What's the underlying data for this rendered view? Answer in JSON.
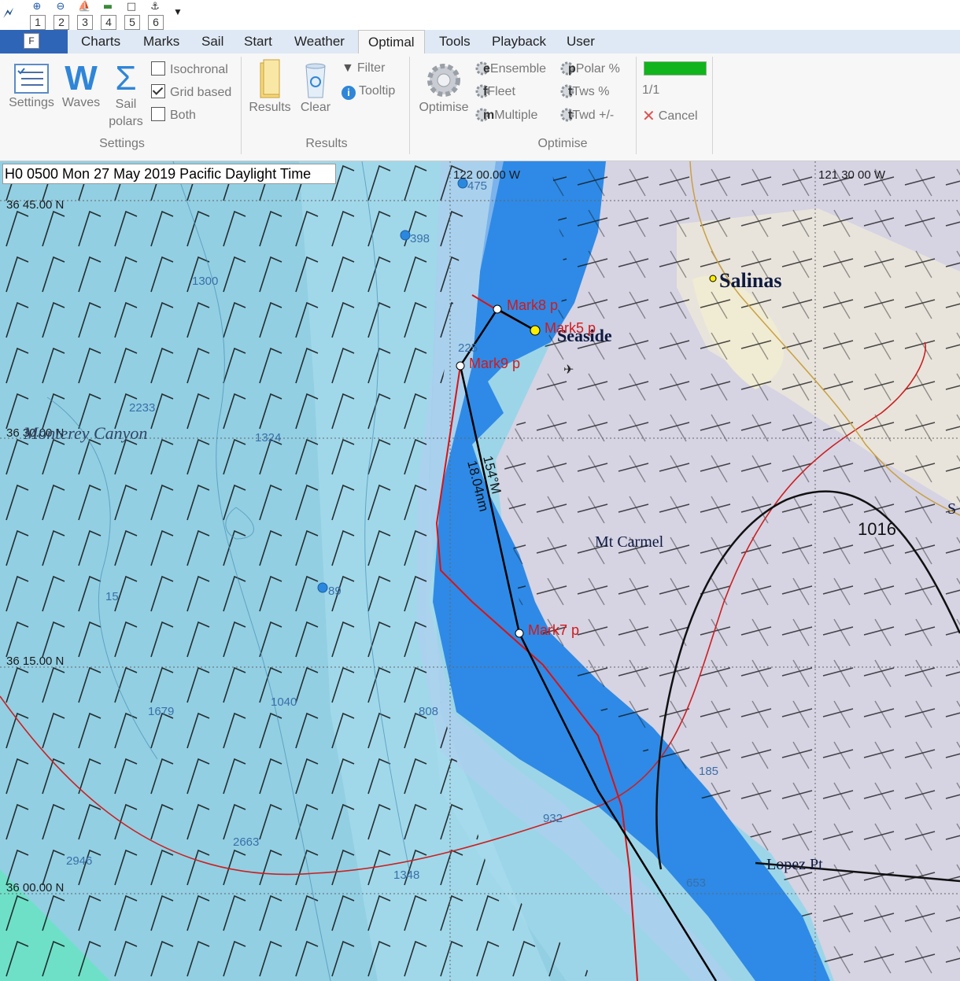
{
  "quick_access": {
    "buttons": [
      {
        "num": "1",
        "icon": "zoom-in-icon"
      },
      {
        "num": "2",
        "icon": "zoom-out-icon"
      },
      {
        "num": "3",
        "icon": "sail-icon"
      },
      {
        "num": "4",
        "icon": "chart-icon"
      },
      {
        "num": "5",
        "icon": "page-icon"
      },
      {
        "num": "6",
        "icon": "boat-icon"
      }
    ],
    "file_key": "F"
  },
  "tabs": [
    "Charts",
    "Marks",
    "Sail",
    "Start",
    "Weather",
    "Optimal",
    "Tools",
    "Playback",
    "User"
  ],
  "active_tab": "Optimal",
  "ribbon": {
    "settings_group": {
      "label": "Settings",
      "settings": "Settings",
      "waves": "Waves",
      "sail": "Sail",
      "polars": "polars",
      "isochronal": "Isochronal",
      "grid_based": "Grid based",
      "both": "Both",
      "isochronal_checked": false,
      "grid_based_checked": true,
      "both_checked": false
    },
    "results_group": {
      "label": "Results",
      "results": "Results",
      "clear": "Clear",
      "filter": "Filter",
      "tooltip": "Tooltip"
    },
    "optimise_group": {
      "label": "Optimise",
      "optimise": "Optimise",
      "ensemble": "Ensemble",
      "fleet": "Fleet",
      "multiple": "Multiple",
      "polar": "Polar %",
      "tws": "Tws %",
      "twd": "Twd +/-",
      "ensemble_letter": "e",
      "fleet_letter": "f",
      "multiple_letter": "m",
      "polar_letter": "p",
      "tws_letter": "t",
      "twd_letter": "t",
      "progress_text": "1/1",
      "progress": 1.0,
      "progress_color": "#11b41c",
      "cancel": "Cancel"
    }
  },
  "map": {
    "time": "H0 0500 Mon 27 May 2019 Pacific Daylight Time",
    "lon_labels": [
      "122 00.00 W",
      "121 30 00 W"
    ],
    "lat_labels": [
      "36 45.00 N",
      "36 30.00 N",
      "36 15.00 N",
      "36 00.00 N"
    ],
    "places": [
      "Salinas",
      "Seaside",
      "Mt Carmel",
      "Lopez Pt",
      "S"
    ],
    "feature": "Monterey Canyon",
    "marks": [
      "Mark8 p",
      "Mark5 p",
      "Mark9 p",
      "Mark7 p"
    ],
    "depths": [
      "475",
      "398",
      "1300",
      "2233",
      "1324",
      "15",
      "89",
      "1679",
      "1040",
      "808",
      "2663",
      "2946",
      "1348",
      "932",
      "653",
      "225",
      "185"
    ],
    "pressure": "1016",
    "route_bearing": "154°M",
    "route_distance": "18.04nm"
  },
  "colors": {
    "ocean_deep": "#92d2e4",
    "ocean_mid": "#a8d8ea",
    "shallow": "#2f8ee6",
    "land": "#d6d3e3",
    "land_highlight": "#f0ebd3",
    "route": "#000000",
    "optimal_route": "#dd1111",
    "mark_label": "#d21a1a",
    "ribbon_bg": "#f7f7f7",
    "tab_bg": "#dfe9f5",
    "file_tab": "#2f65b7"
  }
}
